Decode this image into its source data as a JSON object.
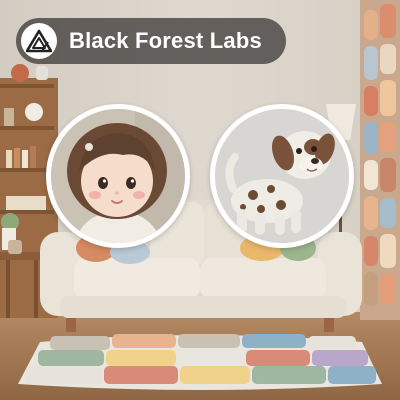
{
  "brand": {
    "name": "Black Forest Labs",
    "logo_icon": "bfl-triangle-logo-icon"
  },
  "scene": {
    "subject": "felted-wool living room with sofa, rug, bookshelf and knitted curtain",
    "palette": {
      "wall": "#d8d2c8",
      "sofa": "#e9e2d7",
      "floor": "#a77b56",
      "rug_colors": [
        "#c9c2b4",
        "#e8b48f",
        "#d98a78",
        "#9fb6a0",
        "#b8a7c9",
        "#f0d28a",
        "#8fb1c7",
        "#e9e6df"
      ]
    }
  }
}
